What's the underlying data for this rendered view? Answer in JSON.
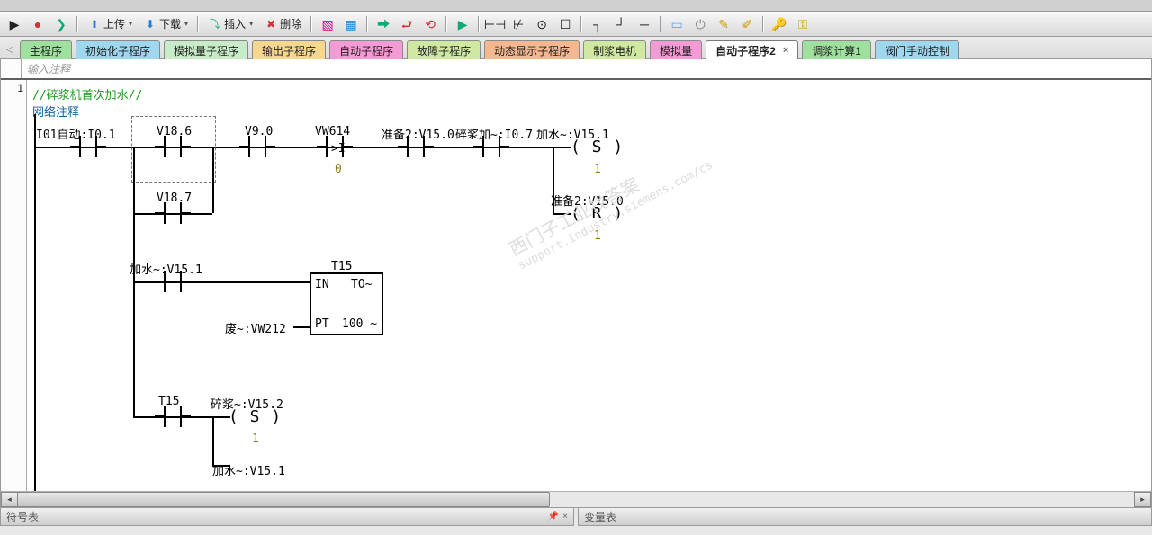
{
  "toolbar": {
    "upload_label": "上传",
    "download_label": "下载",
    "insert_label": "插入",
    "delete_label": "删除"
  },
  "tabs": [
    {
      "label": "主程序",
      "bg": "#9fe09f"
    },
    {
      "label": "初始化子程序",
      "bg": "#9ed7ee"
    },
    {
      "label": "模拟量子程序",
      "bg": "#c8ebc8"
    },
    {
      "label": "输出子程序",
      "bg": "#f6d78f"
    },
    {
      "label": "自动子程序",
      "bg": "#f49ad5"
    },
    {
      "label": "故障子程序",
      "bg": "#d0e8a2"
    },
    {
      "label": "动态显示子程序",
      "bg": "#f4b78f"
    },
    {
      "label": "制浆电机",
      "bg": "#d0e8a2"
    },
    {
      "label": "模拟量",
      "bg": "#f49ad5"
    },
    {
      "label": "自动子程序2",
      "bg": "#ffffff",
      "active": true
    },
    {
      "label": "调浆计算1",
      "bg": "#9fe09f"
    },
    {
      "label": "阀门手动控制",
      "bg": "#9ed7ee"
    }
  ],
  "tab_close_glyph": "×",
  "comment_placeholder": "输入注释",
  "network_number": "1",
  "network_title": "//碎浆机首次加水//",
  "network_comment": "网络注释",
  "labels": {
    "c1": "I01自动:I0.1",
    "c2": "V18.6",
    "c3": "V9.0",
    "c4": "VW614",
    "c5": "准备2:V15.0",
    "c6": "碎浆加~:I0.7",
    "c7": "加水~:V15.1",
    "coil_s1": "( S )",
    "param_s1": "1",
    "c8": "准备2:V15.0",
    "coil_r1": "( R )",
    "param_r1": "1",
    "c9": "V18.7",
    "c10": "加水~:V15.1",
    "t15": "T15",
    "box_in": "IN",
    "box_to": "TO~",
    "box_ptlabel": "废~:VW212",
    "box_pt": "PT",
    "box_ptv": "100 ~",
    "c11": "T15",
    "c12": "碎浆~:V15.2",
    "coil_s2": "( S )",
    "param_s2": "1",
    "c13": "加水~:V15.1",
    "cmp_op": ">I",
    "cmp_val": "0"
  },
  "bottom": {
    "left": "符号表",
    "right": "变量表"
  },
  "watermark_lines": [
    "西门子工业找答案",
    "support.industry.siemens.com/cs"
  ]
}
